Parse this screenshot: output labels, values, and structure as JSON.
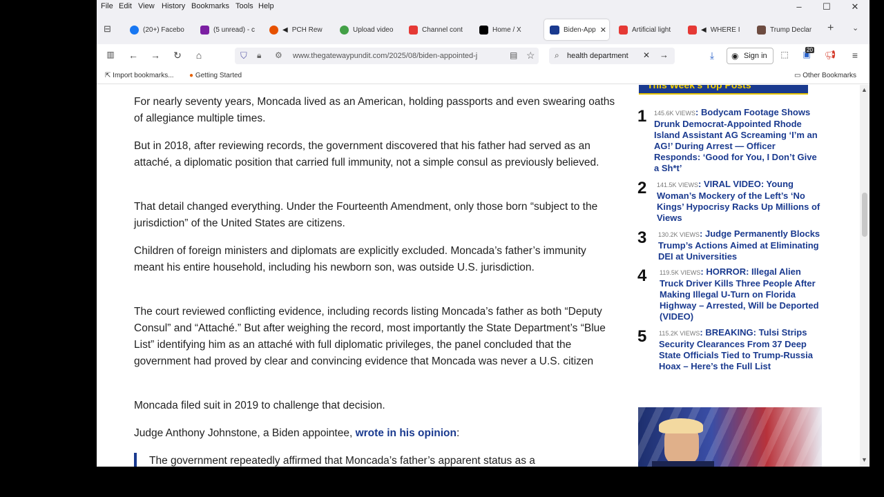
{
  "menu": [
    "File",
    "Edit",
    "View",
    "History",
    "Bookmarks",
    "Tools",
    "Help"
  ],
  "tabs": [
    {
      "label": "(20+) Facebo",
      "color": "#1877f2"
    },
    {
      "label": "(5 unread) - c",
      "color": "#7b1fa2"
    },
    {
      "label": "PCH Rew",
      "color": "#e65100"
    },
    {
      "label": "Upload video",
      "color": "#43a047"
    },
    {
      "label": "Channel cont",
      "color": "#e53935"
    },
    {
      "label": "Home / X",
      "color": "#000000"
    },
    {
      "label": "Biden-App",
      "color": "#1a3a8f"
    },
    {
      "label": "Artificial light",
      "color": "#e53935"
    },
    {
      "label": "WHERE I",
      "color": "#e53935"
    },
    {
      "label": "Trump Declar",
      "color": "#6d4c41"
    }
  ],
  "url": "www.thegatewaypundit.com/2025/08/biden-appointed-j",
  "search": "health department",
  "signin": "Sign in",
  "badge_count": "20",
  "bookmarks": {
    "import": "Import bookmarks...",
    "started": "Getting Started",
    "other": "Other Bookmarks"
  },
  "article": {
    "p1": "For nearly seventy years, Moncada lived as an American, holding passports and even swearing oaths of allegiance multiple times.",
    "p2": "But in 2018, after reviewing records, the government discovered that his father had served as an attaché, a diplomatic position that carried full immunity, not a simple consul as previously believed.",
    "p3": "That detail changed everything. Under the Fourteenth Amendment, only those born “subject to the jurisdiction” of the United States are citizens.",
    "p4": "Children of foreign ministers and diplomats are explicitly excluded. Moncada’s father’s immunity meant his entire household, including his newborn son, was outside U.S. jurisdiction.",
    "p5": "The court reviewed conflicting evidence, including records listing Moncada’s father as both “Deputy Consul” and “Attaché.” But after weighing the record, most importantly the State Department’s “Blue List” identifying him as an attaché with full diplomatic privileges, the panel concluded that the government had proved by clear and convincing evidence that Moncada was never a U.S. citizen",
    "p6": "Moncada filed suit in 2019 to challenge that decision.",
    "p7_prefix": "Judge Anthony Johnstone, a Biden appointee, ",
    "p7_link": "wrote in his opinion",
    "p7_suffix": ":",
    "quote": "The government repeatedly affirmed that Moncada’s father’s apparent status as a"
  },
  "sidebar": {
    "heading": "This Week's Top Posts",
    "posts": [
      {
        "num": "1",
        "views": "145.6K VIEWS",
        "title": "Bodycam Footage Shows Drunk Democrat-Appointed Rhode Island Assistant AG Screaming ‘I’m an AG!’ During Arrest — Officer Responds: ‘Good for You, I Don’t Give a Sh*t’"
      },
      {
        "num": "2",
        "views": "141.5K VIEWS",
        "title": "VIRAL VIDEO: Young Woman’s Mockery of the Left’s ‘No Kings’ Hypocrisy Racks Up Millions of Views"
      },
      {
        "num": "3",
        "views": "130.2K VIEWS",
        "title": "Judge Permanently Blocks Trump’s Actions Aimed at Eliminating DEI at Universities"
      },
      {
        "num": "4",
        "views": "119.5K VIEWS",
        "title": "HORROR: Illegal Alien Truck Driver Kills Three People After Making Illegal U-Turn on Florida Highway – Arrested, Will be Deported (VIDEO)"
      },
      {
        "num": "5",
        "views": "115.2K VIEWS",
        "title": "BREAKING: Tulsi Strips Security Clearances From 37 Deep State Officials Tied to Trump-Russia Hoax – Here’s the Full List"
      }
    ]
  }
}
